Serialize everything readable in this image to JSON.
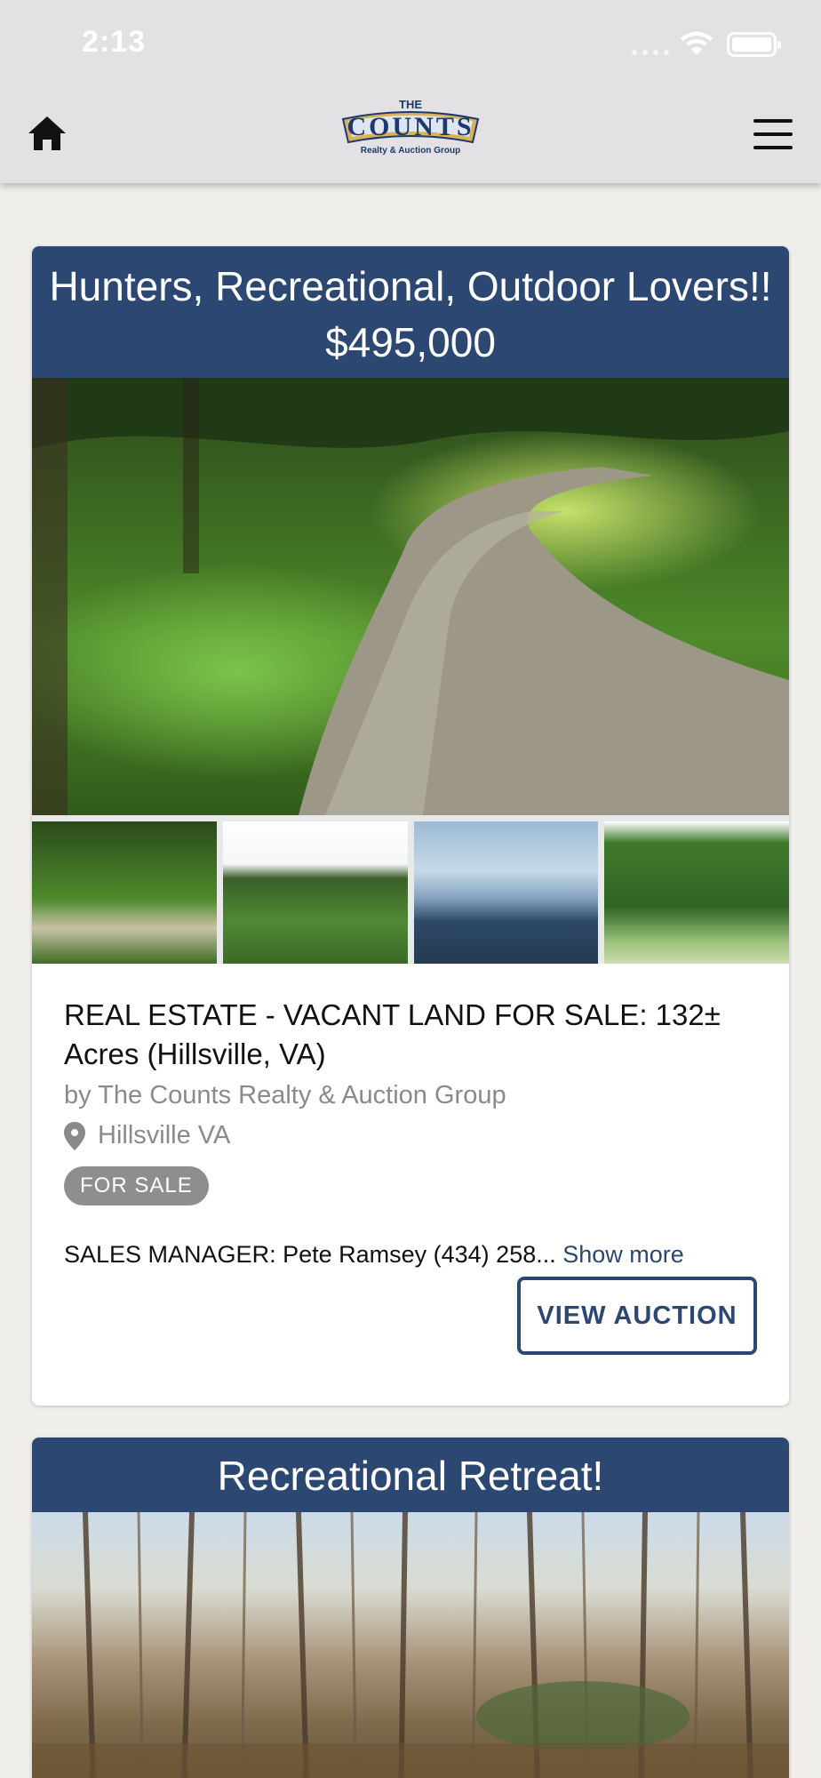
{
  "status_bar": {
    "time": "2:13"
  },
  "app_bar": {
    "logo": {
      "the": "THE",
      "name": "COUNTS",
      "subtitle": "Realty & Auction Group"
    }
  },
  "listings": [
    {
      "headline": "Hunters, Recreational, Outdoor Lovers!!",
      "price": "$495,000",
      "title": "REAL ESTATE - VACANT LAND FOR SALE: 132± Acres (Hillsville, VA)",
      "by": "by The Counts Realty & Auction Group",
      "location": "Hillsville VA",
      "badge": "FOR SALE",
      "description": "SALES MANAGER: Pete Ramsey (434) 258...",
      "show_more": "Show more",
      "button": "VIEW AUCTION"
    },
    {
      "headline": "Recreational Retreat!"
    }
  ],
  "colors": {
    "header_blue": "#2c4771",
    "badge_gray": "#8e8e8e"
  }
}
